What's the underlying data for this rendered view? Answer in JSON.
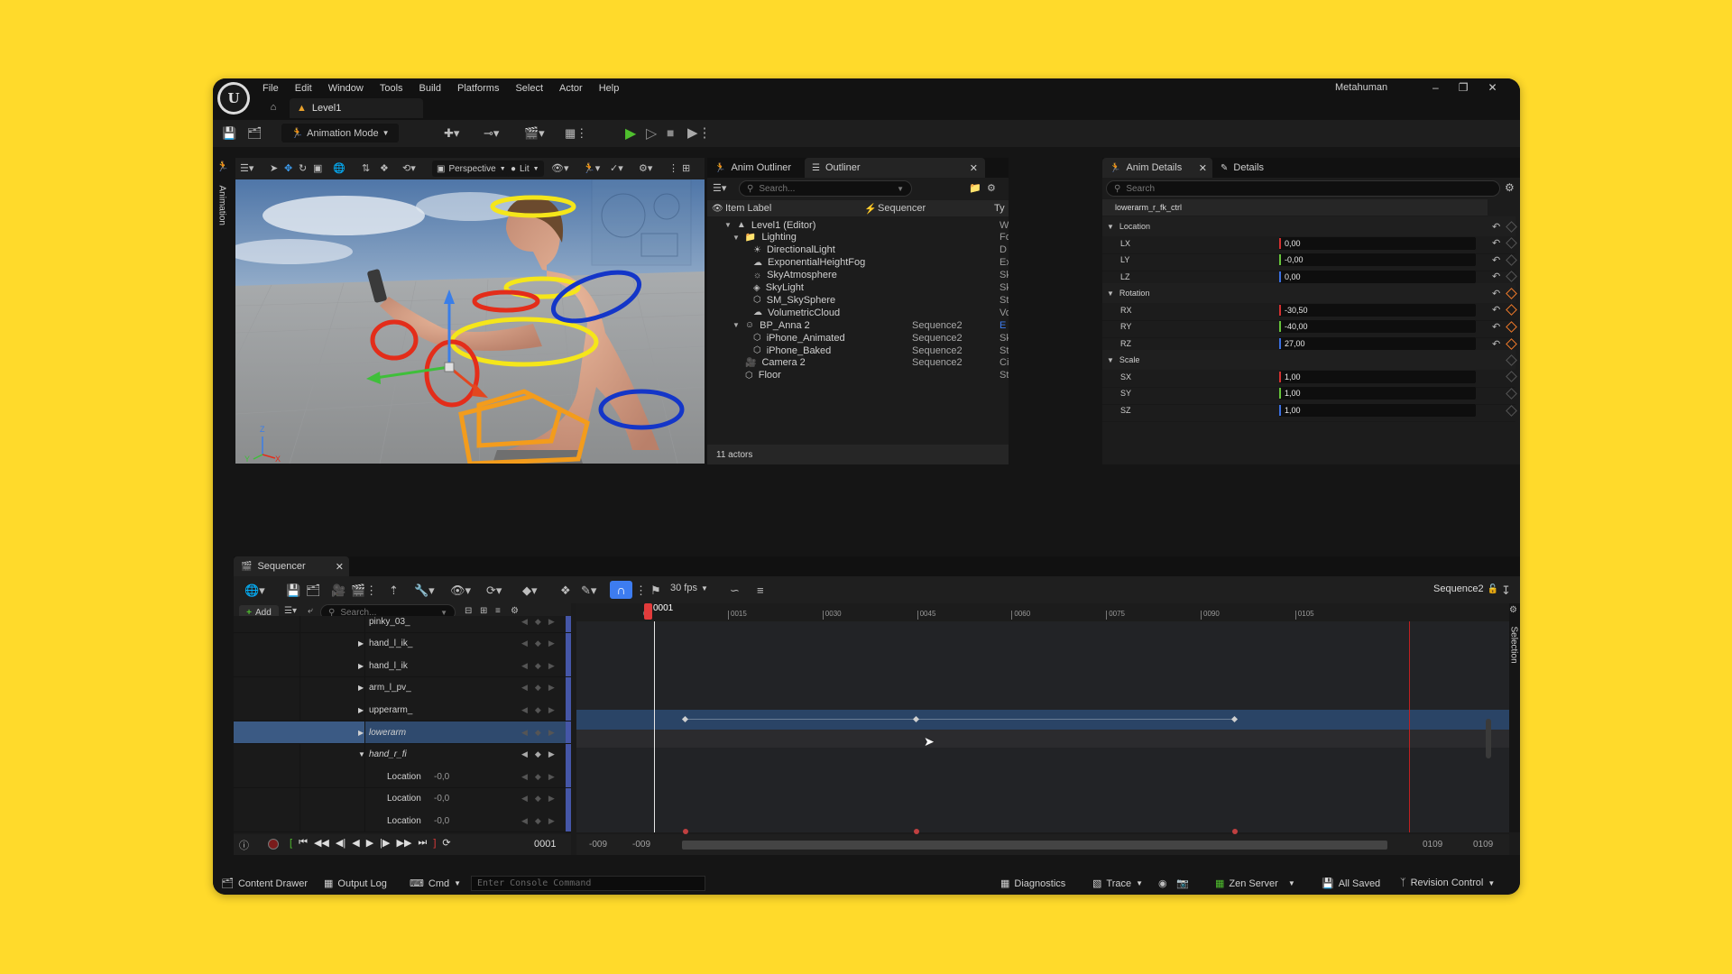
{
  "app": {
    "project_name": "Metahuman",
    "level_tab": "Level1",
    "mode_button": "Animation Mode",
    "menu": [
      "File",
      "Edit",
      "Window",
      "Tools",
      "Build",
      "Platforms",
      "Select",
      "Actor",
      "Help"
    ]
  },
  "viewport": {
    "side_tab": "Animation",
    "perspective": "Perspective",
    "lit": "Lit",
    "axes": {
      "x": "X",
      "y": "Y",
      "z": "Z"
    }
  },
  "outliner": {
    "tabs": [
      "Anim Outliner",
      "Outliner"
    ],
    "search_placeholder": "Search...",
    "columns": {
      "label": "Item Label",
      "sequencer": "Sequencer",
      "type": "Ty"
    },
    "rows": [
      {
        "label": "Level1 (Editor)",
        "indent": 1,
        "expand": "open",
        "icon": "level-icon",
        "seq": "",
        "type": "W"
      },
      {
        "label": "Lighting",
        "indent": 2,
        "expand": "open",
        "icon": "folder-icon",
        "seq": "",
        "type": "Fo"
      },
      {
        "label": "DirectionalLight",
        "indent": 3,
        "expand": "",
        "icon": "sun-icon",
        "seq": "",
        "type": "D"
      },
      {
        "label": "ExponentialHeightFog",
        "indent": 3,
        "expand": "",
        "icon": "fog-icon",
        "seq": "",
        "type": "Ex"
      },
      {
        "label": "SkyAtmosphere",
        "indent": 3,
        "expand": "",
        "icon": "atmosphere-icon",
        "seq": "",
        "type": "Sk"
      },
      {
        "label": "SkyLight",
        "indent": 3,
        "expand": "",
        "icon": "skylight-icon",
        "seq": "",
        "type": "Sk"
      },
      {
        "label": "SM_SkySphere",
        "indent": 3,
        "expand": "",
        "icon": "mesh-icon",
        "seq": "",
        "type": "St"
      },
      {
        "label": "VolumetricCloud",
        "indent": 3,
        "expand": "",
        "icon": "cloud-icon",
        "seq": "",
        "type": "Vo"
      },
      {
        "label": "BP_Anna 2",
        "indent": 2,
        "expand": "open",
        "icon": "character-icon",
        "seq": "Sequence2",
        "type": "E"
      },
      {
        "label": "iPhone_Animated",
        "indent": 3,
        "expand": "",
        "icon": "mesh-icon",
        "seq": "Sequence2",
        "type": "Sk"
      },
      {
        "label": "iPhone_Baked",
        "indent": 3,
        "expand": "",
        "icon": "mesh-icon",
        "seq": "Sequence2",
        "type": "St"
      },
      {
        "label": "Camera 2",
        "indent": 2,
        "expand": "",
        "icon": "camera-icon",
        "seq": "Sequence2",
        "type": "Ci"
      },
      {
        "label": "Floor",
        "indent": 2,
        "expand": "",
        "icon": "mesh-icon",
        "seq": "",
        "type": "St"
      }
    ],
    "footer": "11 actors"
  },
  "details": {
    "tabs": [
      "Anim Details",
      "Details"
    ],
    "search_placeholder": "Search",
    "control_name": "lowerarm_r_fk_ctrl",
    "categories": [
      {
        "name": "Location",
        "fields": [
          {
            "name": "LX",
            "value": "0,00",
            "color": "#d33030"
          },
          {
            "name": "LY",
            "value": "-0,00",
            "color": "#66c33a"
          },
          {
            "name": "LZ",
            "value": "0,00",
            "color": "#3a6fe0"
          }
        ]
      },
      {
        "name": "Rotation",
        "fields": [
          {
            "name": "RX",
            "value": "-30,50",
            "color": "#d33030"
          },
          {
            "name": "RY",
            "value": "-40,00",
            "color": "#66c33a"
          },
          {
            "name": "RZ",
            "value": "27,00",
            "color": "#3a6fe0"
          }
        ]
      },
      {
        "name": "Scale",
        "fields": [
          {
            "name": "SX",
            "value": "1,00",
            "color": "#d33030"
          },
          {
            "name": "SY",
            "value": "1,00",
            "color": "#66c33a"
          },
          {
            "name": "SZ",
            "value": "1,00",
            "color": "#3a6fe0"
          }
        ]
      }
    ]
  },
  "sequencer": {
    "tab": "Sequencer",
    "fps": "30 fps",
    "sequence_name": "Sequence2",
    "add_label": "Add",
    "search_placeholder": "Search...",
    "current_frame": "0001",
    "frame_field": "0001",
    "ruler": [
      "0015",
      "0030",
      "0045",
      "0060",
      "0075",
      "0090",
      "0105"
    ],
    "ruler_start": "00",
    "range": {
      "left1": "-009",
      "left2": "-009",
      "right1": "0109",
      "right2": "0109"
    },
    "selection_tab": "Selection",
    "tracks": [
      {
        "name": "pinky_03_",
        "indent": 150,
        "expand": "",
        "value": "",
        "selected": false
      },
      {
        "name": "hand_l_ik_",
        "indent": 150,
        "expand": "closed",
        "value": "",
        "selected": false
      },
      {
        "name": "hand_l_ik",
        "indent": 150,
        "expand": "closed",
        "value": "",
        "selected": false
      },
      {
        "name": "arm_l_pv_",
        "indent": 150,
        "expand": "closed",
        "value": "",
        "selected": false
      },
      {
        "name": "upperarm_",
        "indent": 150,
        "expand": "closed",
        "value": "",
        "selected": false
      },
      {
        "name": "lowerarm",
        "indent": 150,
        "expand": "closed",
        "value": "",
        "selected": true
      },
      {
        "name": "hand_r_fi",
        "indent": 150,
        "expand": "open",
        "value": "",
        "selected": false
      },
      {
        "name": "Location",
        "indent": 170,
        "expand": "",
        "value": "-0,0",
        "selected": false
      },
      {
        "name": "Location",
        "indent": 170,
        "expand": "",
        "value": "-0,0",
        "selected": false
      },
      {
        "name": "Location",
        "indent": 170,
        "expand": "",
        "value": "-0,0",
        "selected": false
      }
    ]
  },
  "statusbar": {
    "content_drawer": "Content Drawer",
    "output_log": "Output Log",
    "cmd": "Cmd",
    "console_placeholder": "Enter Console Command",
    "diagnostics": "Diagnostics",
    "trace": "Trace",
    "zen_server": "Zen Server",
    "all_saved": "All Saved",
    "revision_control": "Revision Control"
  },
  "colors": {
    "accent": "#3d7cf0",
    "playhead": "#e23b3b",
    "selected_row": "#2a4466",
    "play_green": "#4fbf2e"
  }
}
